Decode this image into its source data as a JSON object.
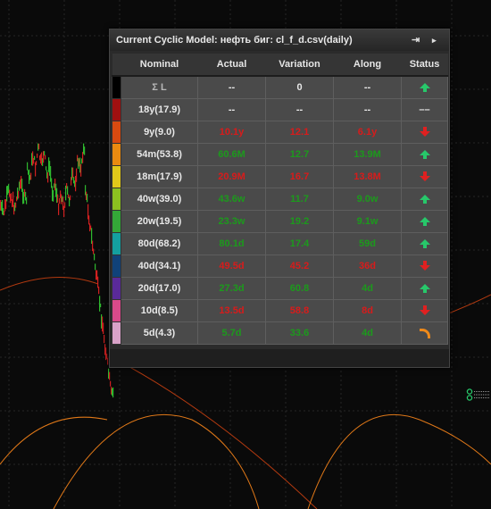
{
  "panel": {
    "title": "Current Cyclic Model: нефть биг: cl_f_d.csv(daily)",
    "pin_icon": "pin-icon",
    "menu_icon": "triangle-right-icon"
  },
  "table": {
    "headers": [
      "Nominal",
      "Actual",
      "Variation",
      "Along",
      "Status"
    ],
    "rows": [
      {
        "color": "#000000",
        "nominal": "Σ L",
        "actual": "--",
        "variation": "0",
        "along": "--",
        "status": "up-arrow-icon",
        "tone": "w"
      },
      {
        "color": "#a01010",
        "nominal": "18y(17.9)",
        "actual": "--",
        "variation": "--",
        "along": "--",
        "status": "dash-icon",
        "tone": "w"
      },
      {
        "color": "#d84a10",
        "nominal": "9y(9.0)",
        "actual": "10.1y",
        "variation": "12.1",
        "along": "6.1y",
        "status": "down-arrow-icon",
        "tone": "r"
      },
      {
        "color": "#ea8a10",
        "nominal": "54m(53.8)",
        "actual": "60.6M",
        "variation": "12.7",
        "along": "13.9M",
        "status": "up-arrow-icon",
        "tone": "g"
      },
      {
        "color": "#e2c81a",
        "nominal": "18m(17.9)",
        "actual": "20.9M",
        "variation": "16.7",
        "along": "13.8M",
        "status": "down-arrow-icon",
        "tone": "r"
      },
      {
        "color": "#8cc020",
        "nominal": "40w(39.0)",
        "actual": "43.6w",
        "variation": "11.7",
        "along": "9.0w",
        "status": "up-arrow-icon",
        "tone": "g"
      },
      {
        "color": "#34a838",
        "nominal": "20w(19.5)",
        "actual": "23.3w",
        "variation": "19.2",
        "along": "9.1w",
        "status": "up-arrow-icon",
        "tone": "g"
      },
      {
        "color": "#14a0a0",
        "nominal": "80d(68.2)",
        "actual": "80.1d",
        "variation": "17.4",
        "along": "59d",
        "status": "up-arrow-icon",
        "tone": "g"
      },
      {
        "color": "#10427a",
        "nominal": "40d(34.1)",
        "actual": "49.5d",
        "variation": "45.2",
        "along": "36d",
        "status": "down-arrow-icon",
        "tone": "r"
      },
      {
        "color": "#5a2a9a",
        "nominal": "20d(17.0)",
        "actual": "27.3d",
        "variation": "60.8",
        "along": "4d",
        "status": "up-arrow-icon",
        "tone": "g"
      },
      {
        "color": "#d84a8a",
        "nominal": "10d(8.5)",
        "actual": "13.5d",
        "variation": "58.8",
        "along": "8d",
        "status": "down-arrow-icon",
        "tone": "r"
      },
      {
        "color": "#d9a2c8",
        "nominal": "5d(4.3)",
        "actual": "5.7d",
        "variation": "33.6",
        "along": "4d",
        "status": "turn-icon",
        "tone": "g"
      }
    ]
  },
  "colors": {
    "up_arrow": "#27c86a",
    "down_arrow": "#e02020",
    "turn_arrow": "#f08a1a",
    "cycle_curve": "#e07818",
    "cycle_curve_red": "#b33a10"
  }
}
